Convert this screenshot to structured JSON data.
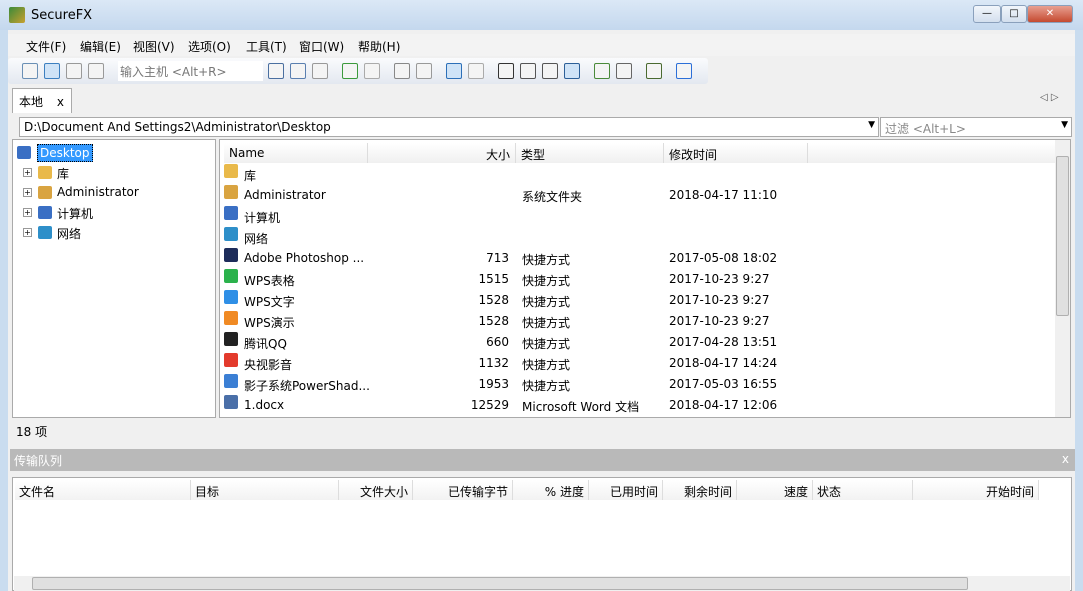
{
  "window": {
    "title": "SecureFX",
    "min": "—",
    "max": "□",
    "close": "✕"
  },
  "menu": [
    "文件(F)",
    "编辑(E)",
    "视图(V)",
    "选项(O)",
    "工具(T)",
    "窗口(W)",
    "帮助(H)"
  ],
  "toolbar": {
    "host_placeholder": "输入主机 <Alt+R>",
    "icons": [
      "quick-connect",
      "connect",
      "reconnect",
      "disconnect",
      "cut",
      "copy",
      "paste",
      "refresh",
      "stop",
      "delete",
      "properties",
      "tree-view",
      "up-folder",
      "large-icons",
      "small-icons",
      "list-view",
      "details-view",
      "sync",
      "key",
      "session-manager",
      "help"
    ]
  },
  "tab": {
    "label": "本地",
    "close": "x"
  },
  "path": {
    "value": "D:\\Document And Settings2\\Administrator\\Desktop",
    "filter_placeholder": "过滤 <Alt+L>"
  },
  "tree": [
    {
      "label": "Desktop",
      "selected": true
    },
    {
      "label": "库"
    },
    {
      "label": "Administrator"
    },
    {
      "label": "计算机"
    },
    {
      "label": "网络"
    }
  ],
  "list": {
    "columns": [
      "Name",
      "大小",
      "类型",
      "修改时间"
    ],
    "rows": [
      {
        "name": "库",
        "size": "",
        "type": "",
        "modified": "",
        "color": "#e9b94a"
      },
      {
        "name": "Administrator",
        "size": "",
        "type": "系统文件夹",
        "modified": "2018-04-17 11:10",
        "color": "#d9a441"
      },
      {
        "name": "计算机",
        "size": "",
        "type": "",
        "modified": "",
        "color": "#3a6fc4"
      },
      {
        "name": "网络",
        "size": "",
        "type": "",
        "modified": "",
        "color": "#2e8fc9"
      },
      {
        "name": "Adobe Photoshop ...",
        "size": "713",
        "type": "快捷方式",
        "modified": "2017-05-08 18:02",
        "color": "#1d2c5a"
      },
      {
        "name": "WPS表格",
        "size": "1515",
        "type": "快捷方式",
        "modified": "2017-10-23 9:27",
        "color": "#2bb24c"
      },
      {
        "name": "WPS文字",
        "size": "1528",
        "type": "快捷方式",
        "modified": "2017-10-23 9:27",
        "color": "#2f8fe6"
      },
      {
        "name": "WPS演示",
        "size": "1528",
        "type": "快捷方式",
        "modified": "2017-10-23 9:27",
        "color": "#f08a24"
      },
      {
        "name": "腾讯QQ",
        "size": "660",
        "type": "快捷方式",
        "modified": "2017-04-28 13:51",
        "color": "#222222"
      },
      {
        "name": "央视影音",
        "size": "1132",
        "type": "快捷方式",
        "modified": "2018-04-17 14:24",
        "color": "#e33a2c"
      },
      {
        "name": "影子系统PowerShad...",
        "size": "1953",
        "type": "快捷方式",
        "modified": "2017-05-03 16:55",
        "color": "#3b7fd4"
      },
      {
        "name": "1.docx",
        "size": "12529",
        "type": "Microsoft Word 文档",
        "modified": "2018-04-17 12:06",
        "color": "#4a6fa8"
      }
    ]
  },
  "status": "18 项",
  "queue": {
    "title": "传输队列",
    "close": "x",
    "columns": [
      "文件名",
      "目标",
      "文件大小",
      "已传输字节",
      "% 进度",
      "已用时间",
      "剩余时间",
      "速度",
      "状态",
      "开始时间"
    ]
  }
}
